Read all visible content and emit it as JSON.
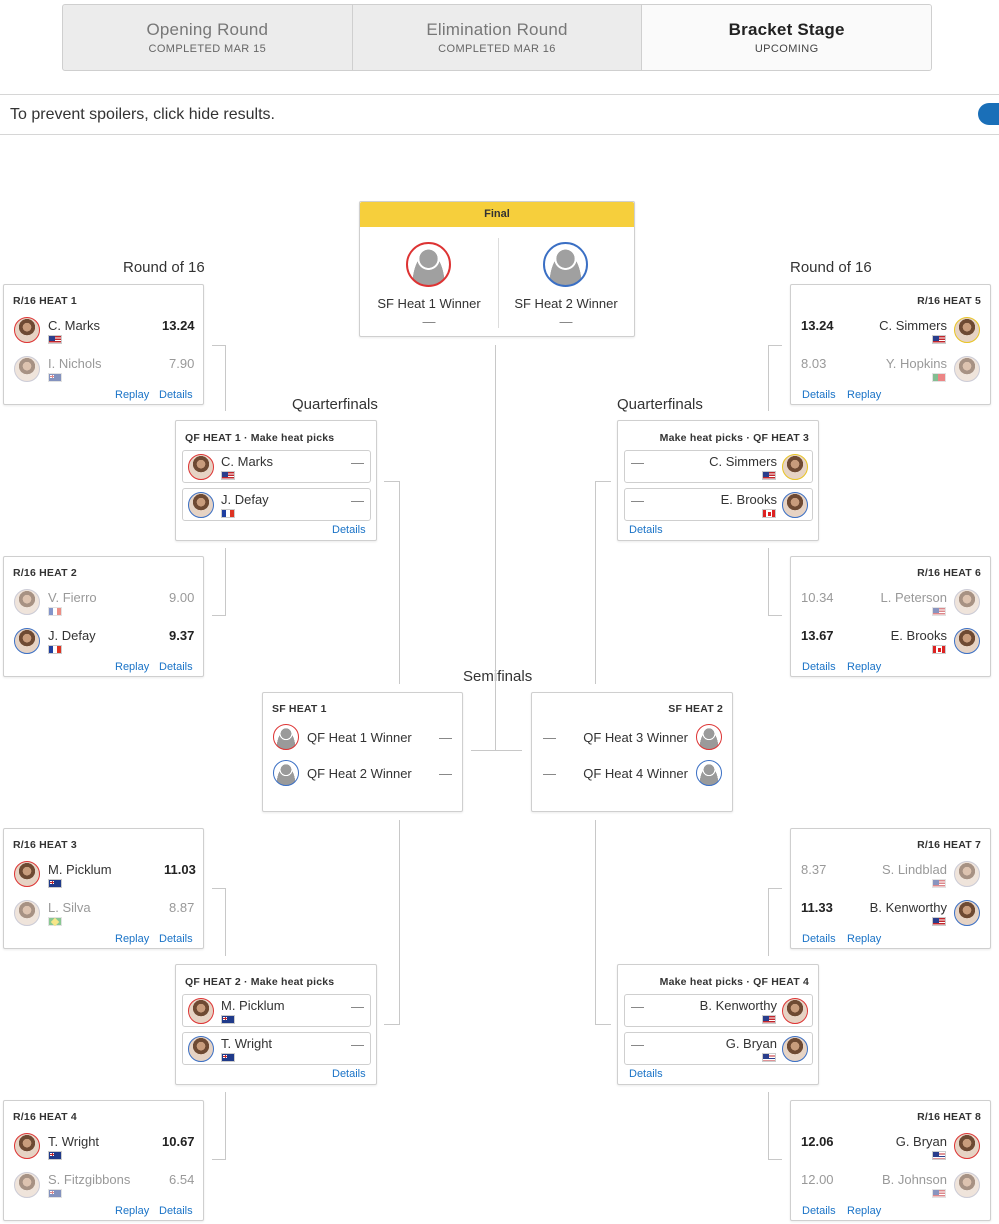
{
  "tabs": [
    {
      "name": "Opening Round",
      "status": "COMPLETED MAR 15"
    },
    {
      "name": "Elimination Round",
      "status": "COMPLETED MAR 16"
    },
    {
      "name": "Bracket Stage",
      "status": "UPCOMING"
    }
  ],
  "spoiler": {
    "text": "To prevent spoilers, click hide results."
  },
  "rounds": {
    "r16": "Round of 16",
    "qf": "Quarterfinals",
    "sf": "Semifinals"
  },
  "links": {
    "replay": "Replay",
    "details": "Details"
  },
  "dash": "—",
  "final": {
    "title": "Final",
    "slots": [
      {
        "name": "SF Heat 1 Winner",
        "score": "—"
      },
      {
        "name": "SF Heat 2 Winner",
        "score": "—"
      }
    ]
  },
  "r16": [
    {
      "title": "R/16 HEAT 1",
      "athletes": [
        {
          "name": "C. Marks",
          "score": "13.24",
          "flag": "usa"
        },
        {
          "name": "I. Nichols",
          "score": "7.90",
          "flag": "aus"
        }
      ]
    },
    {
      "title": "R/16 HEAT 2",
      "athletes": [
        {
          "name": "V. Fierro",
          "score": "9.00",
          "flag": "fra"
        },
        {
          "name": "J. Defay",
          "score": "9.37",
          "flag": "fra"
        }
      ]
    },
    {
      "title": "R/16 HEAT 3",
      "athletes": [
        {
          "name": "M. Picklum",
          "score": "11.03",
          "flag": "aus"
        },
        {
          "name": "L. Silva",
          "score": "8.87",
          "flag": "bra"
        }
      ]
    },
    {
      "title": "R/16 HEAT 4",
      "athletes": [
        {
          "name": "T. Wright",
          "score": "10.67",
          "flag": "aus"
        },
        {
          "name": "S. Fitzgibbons",
          "score": "6.54",
          "flag": "aus"
        }
      ]
    },
    {
      "title": "R/16 HEAT 5",
      "athletes": [
        {
          "name": "C. Simmers",
          "score": "13.24",
          "flag": "usa"
        },
        {
          "name": "Y. Hopkins",
          "score": "8.03",
          "flag": "por"
        }
      ]
    },
    {
      "title": "R/16 HEAT 6",
      "athletes": [
        {
          "name": "L. Peterson",
          "score": "10.34",
          "flag": "usa"
        },
        {
          "name": "E. Brooks",
          "score": "13.67",
          "flag": "can"
        }
      ]
    },
    {
      "title": "R/16 HEAT 7",
      "athletes": [
        {
          "name": "S. Lindblad",
          "score": "8.37",
          "flag": "usa"
        },
        {
          "name": "B. Kenworthy",
          "score": "11.33",
          "flag": "usa"
        }
      ]
    },
    {
      "title": "R/16 HEAT 8",
      "athletes": [
        {
          "name": "G. Bryan",
          "score": "12.06",
          "flag": "haw"
        },
        {
          "name": "B. Johnson",
          "score": "12.00",
          "flag": "usa"
        }
      ]
    }
  ],
  "qf": [
    {
      "title": "QF HEAT 1 · Make heat picks",
      "athletes": [
        {
          "name": "C. Marks",
          "score": "—",
          "flag": "usa"
        },
        {
          "name": "J. Defay",
          "score": "—",
          "flag": "fra"
        }
      ]
    },
    {
      "title": "QF HEAT 2 · Make heat picks",
      "athletes": [
        {
          "name": "M. Picklum",
          "score": "—",
          "flag": "aus"
        },
        {
          "name": "T. Wright",
          "score": "—",
          "flag": "aus"
        }
      ]
    },
    {
      "title": "Make heat picks · QF HEAT 3",
      "athletes": [
        {
          "name": "C. Simmers",
          "score": "—",
          "flag": "usa"
        },
        {
          "name": "E. Brooks",
          "score": "—",
          "flag": "can"
        }
      ]
    },
    {
      "title": "Make heat picks · QF HEAT 4",
      "athletes": [
        {
          "name": "B. Kenworthy",
          "score": "—",
          "flag": "usa"
        },
        {
          "name": "G. Bryan",
          "score": "—",
          "flag": "haw"
        }
      ]
    }
  ],
  "sf": [
    {
      "title": "SF HEAT 1",
      "athletes": [
        {
          "name": "QF Heat 1 Winner",
          "score": "—"
        },
        {
          "name": "QF Heat 2 Winner",
          "score": "—"
        }
      ]
    },
    {
      "title": "SF HEAT 2",
      "athletes": [
        {
          "name": "QF Heat 3 Winner",
          "score": "—"
        },
        {
          "name": "QF Heat 4 Winner",
          "score": "—"
        }
      ]
    }
  ]
}
